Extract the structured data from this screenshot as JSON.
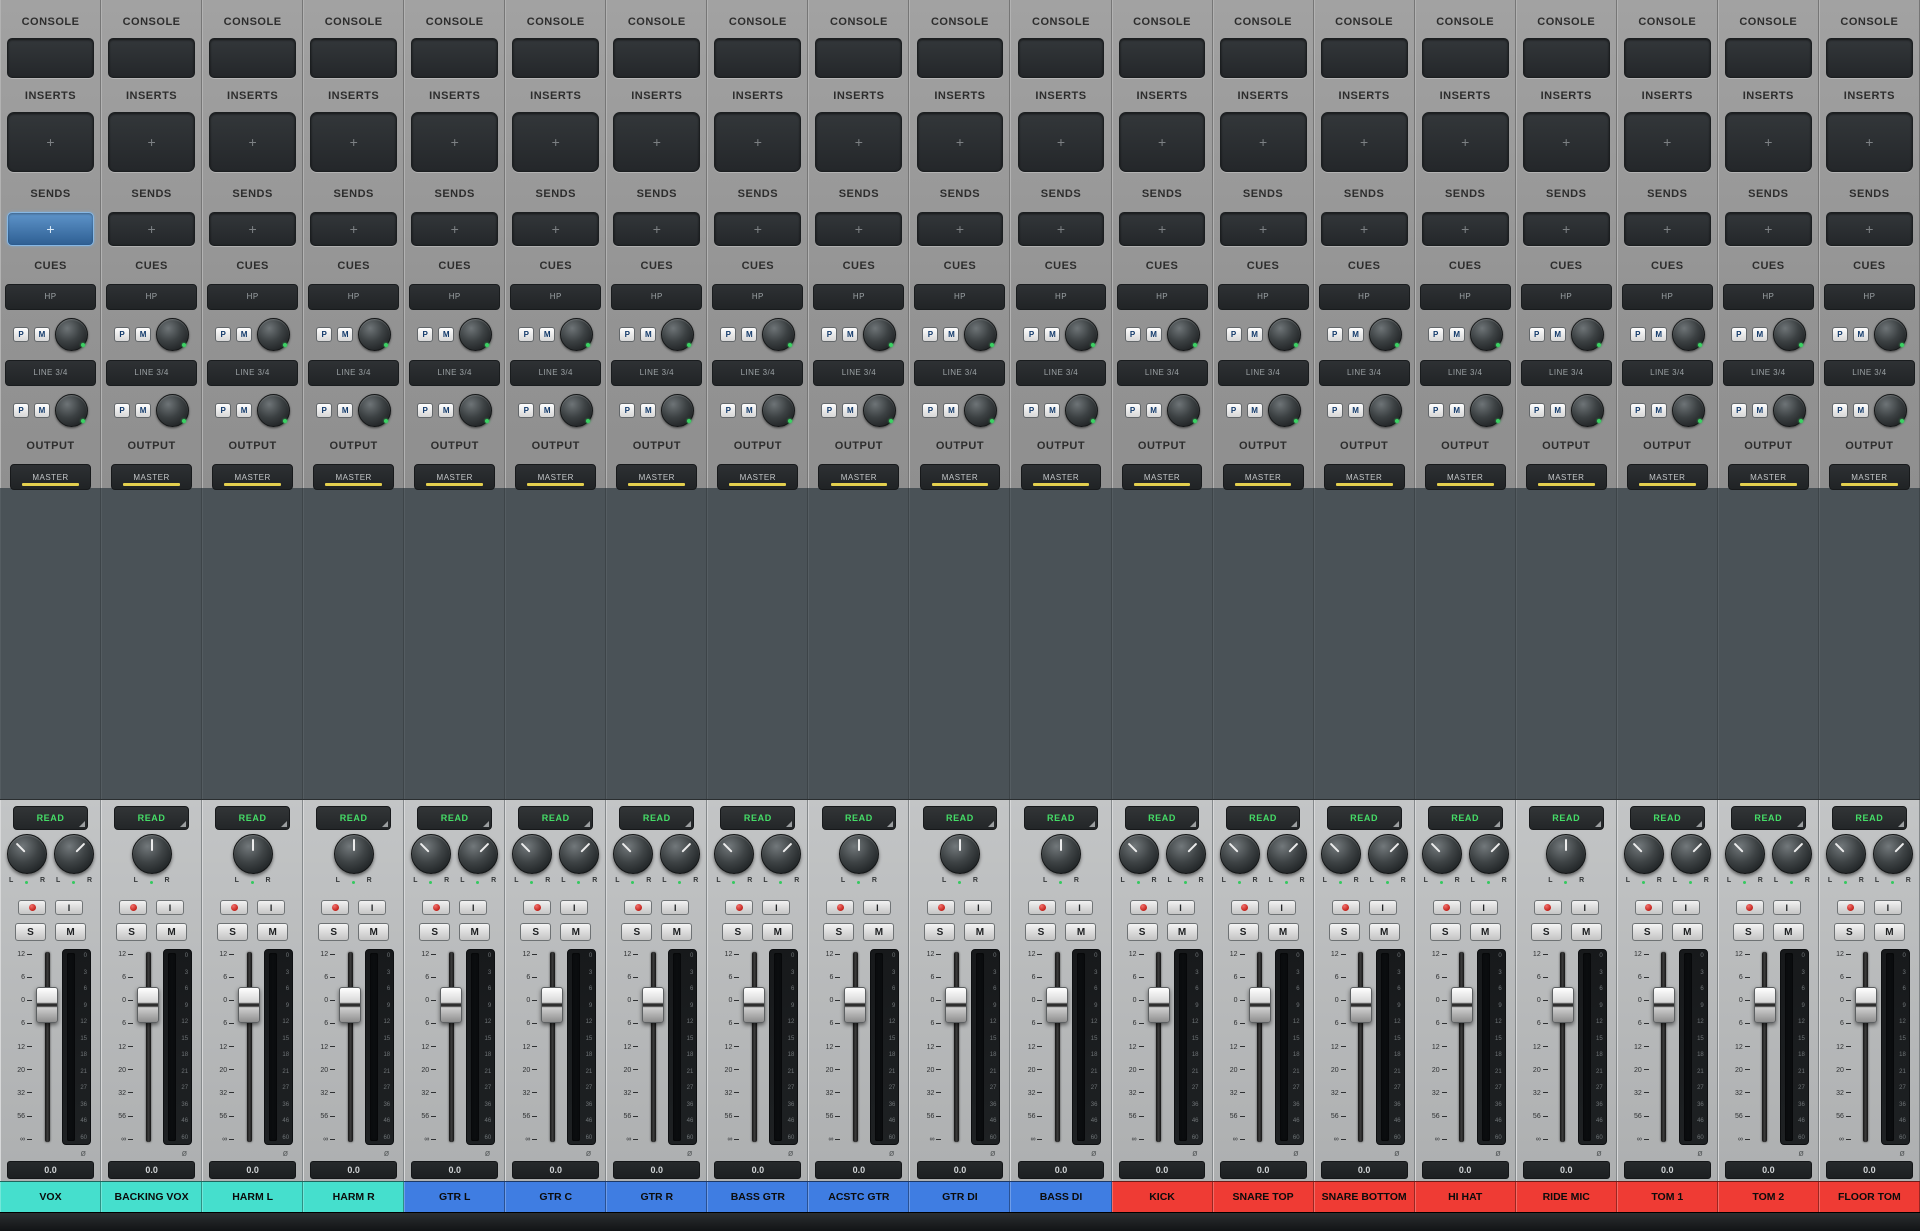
{
  "mixer": {
    "section_labels": {
      "console": "CONSOLE",
      "inserts": "INSERTS",
      "sends": "SENDS",
      "cues": "CUES",
      "output": "OUTPUT"
    },
    "slot_placeholder": "+",
    "cue_buses": [
      {
        "name": "HP"
      },
      {
        "name": "LINE 3/4"
      }
    ],
    "cue_controls": {
      "pan": "P",
      "mute": "M"
    },
    "output_assignment": "MASTER",
    "automation_mode": "READ",
    "pan_left": "L",
    "pan_right": "R",
    "input_monitor": "I",
    "solo": "S",
    "mute": "M",
    "phase_symbol": "ø",
    "volume_readout": "0.0",
    "fader_scale": [
      "12",
      "6",
      "0",
      "6",
      "12",
      "20",
      "32",
      "56",
      "∞"
    ],
    "meter_scale": [
      "0",
      "3",
      "6",
      "9",
      "12",
      "15",
      "18",
      "21",
      "27",
      "36",
      "46",
      "60"
    ],
    "colors": {
      "cyan": "#45dfcd",
      "blue": "#3f7de2",
      "red": "#ef3b34",
      "master_underline": "#e3cf4e",
      "read_text": "#45dd67",
      "sends_active": "#3d6fa8"
    },
    "channels": [
      {
        "name": "VOX",
        "color": "cyan",
        "stereo": true,
        "sends_selected": true
      },
      {
        "name": "BACKING VOX",
        "color": "cyan",
        "stereo": false,
        "sends_selected": false
      },
      {
        "name": "HARM L",
        "color": "cyan",
        "stereo": false,
        "sends_selected": false
      },
      {
        "name": "HARM R",
        "color": "cyan",
        "stereo": false,
        "sends_selected": false
      },
      {
        "name": "GTR L",
        "color": "blue",
        "stereo": true,
        "sends_selected": false
      },
      {
        "name": "GTR C",
        "color": "blue",
        "stereo": true,
        "sends_selected": false
      },
      {
        "name": "GTR R",
        "color": "blue",
        "stereo": true,
        "sends_selected": false
      },
      {
        "name": "BASS GTR",
        "color": "blue",
        "stereo": true,
        "sends_selected": false
      },
      {
        "name": "ACSTC GTR",
        "color": "blue",
        "stereo": false,
        "sends_selected": false
      },
      {
        "name": "GTR DI",
        "color": "blue",
        "stereo": false,
        "sends_selected": false
      },
      {
        "name": "BASS DI",
        "color": "blue",
        "stereo": false,
        "sends_selected": false
      },
      {
        "name": "KICK",
        "color": "red",
        "stereo": true,
        "sends_selected": false
      },
      {
        "name": "SNARE TOP",
        "color": "red",
        "stereo": true,
        "sends_selected": false
      },
      {
        "name": "SNARE BOTTOM",
        "color": "red",
        "stereo": true,
        "sends_selected": false
      },
      {
        "name": "HI HAT",
        "color": "red",
        "stereo": true,
        "sends_selected": false
      },
      {
        "name": "RIDE MIC",
        "color": "red",
        "stereo": false,
        "sends_selected": false
      },
      {
        "name": "TOM 1",
        "color": "red",
        "stereo": true,
        "sends_selected": false
      },
      {
        "name": "TOM 2",
        "color": "red",
        "stereo": true,
        "sends_selected": false
      },
      {
        "name": "FLOOR TOM",
        "color": "red",
        "stereo": true,
        "sends_selected": false
      }
    ]
  }
}
